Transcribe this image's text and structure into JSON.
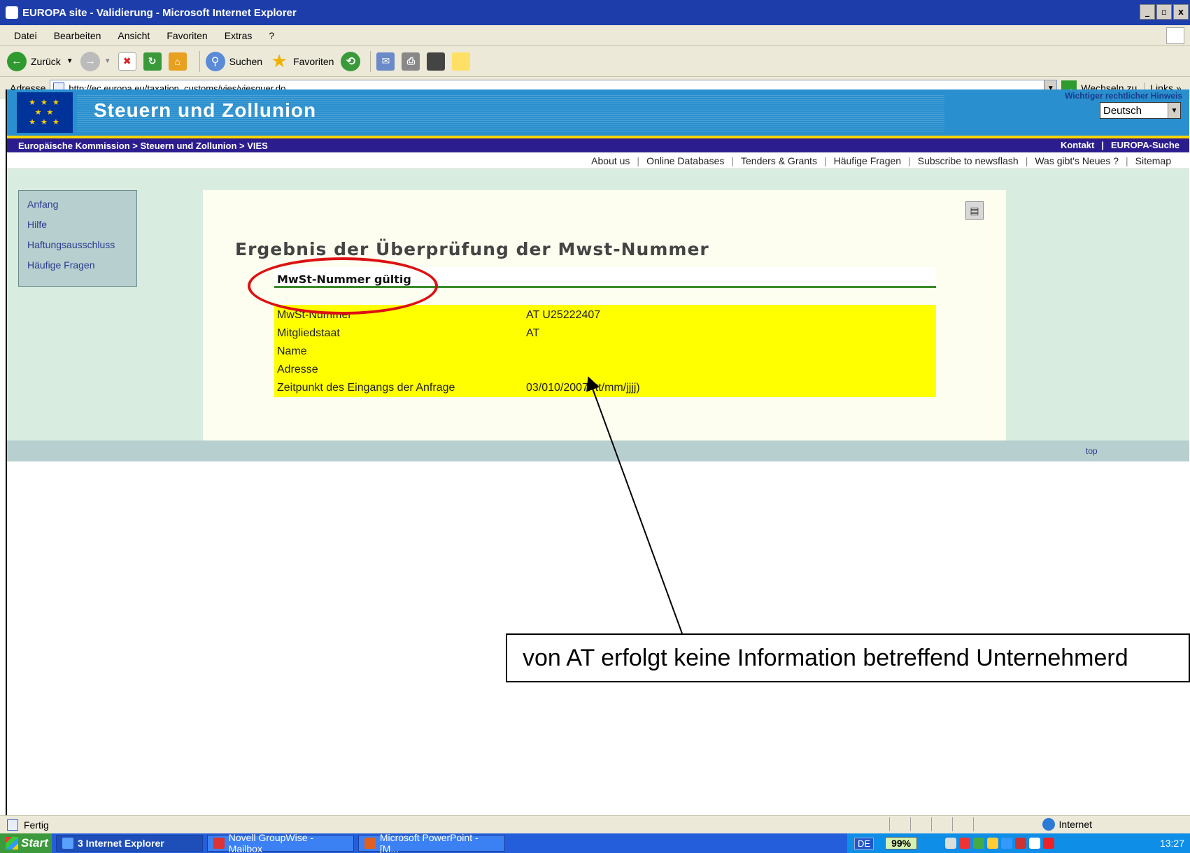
{
  "window": {
    "title": "EUROPA site - Validierung - Microsoft Internet Explorer",
    "controls": [
      "_",
      " ",
      "x"
    ]
  },
  "menu": [
    "Datei",
    "Bearbeiten",
    "Ansicht",
    "Favoriten",
    "Extras",
    "?"
  ],
  "toolbar": {
    "back_label": "Zurück",
    "search_label": "Suchen",
    "favorites_label": "Favoriten"
  },
  "address": {
    "label": "Adresse",
    "url": "http://ec.europa.eu/taxation_customs/vies/viesquer.do",
    "go_label": "Wechseln zu",
    "links_label": "Links »"
  },
  "banner": {
    "site_title": "Steuern und Zollunion",
    "legal_notice": "Wichtiger rechtlicher Hinweis",
    "language": "Deutsch"
  },
  "breadcrumb": "Europäische Kommission > Steuern und Zollunion > VIES",
  "nav_right": [
    "Kontakt",
    "EUROPA-Suche"
  ],
  "top_links": [
    "About us",
    "Online Databases",
    "Tenders & Grants",
    "Häufige Fragen",
    "Subscribe to newsflash",
    "Was gibt's Neues ?",
    "Sitemap"
  ],
  "left_nav": [
    "Anfang",
    "Hilfe",
    "Haftungsausschluss",
    "Häufige Fragen"
  ],
  "main": {
    "heading": "Ergebnis der Überprüfung der Mwst-Nummer",
    "result": "MwSt-Nummer gültig",
    "rows": [
      {
        "key": "MwSt-Nummer",
        "value": "AT U25222407"
      },
      {
        "key": "Mitgliedstaat",
        "value": "AT"
      },
      {
        "key": "Name",
        "value": ""
      },
      {
        "key": "Adresse",
        "value": ""
      },
      {
        "key": "Zeitpunkt des Eingangs der Anfrage",
        "value": "03/010/2007 (tt/mm/jjjj)"
      }
    ]
  },
  "footer_top_link": "top",
  "annotation": "von AT erfolgt keine Information betreffend Unternehmerd",
  "status": {
    "text": "Fertig",
    "zone": "Internet"
  },
  "taskbar": {
    "start_label": "Start",
    "tasks": [
      "3 Internet Explorer",
      "Novell GroupWise - Mailbox",
      "Microsoft PowerPoint - [M..."
    ],
    "lang": "DE",
    "battery": "99%",
    "clock": "13:27"
  },
  "colors": {
    "banner_blue": "#2a8fce",
    "nav_purple": "#2c1d8f",
    "highlight_yellow": "#ffff00",
    "annotation_red": "#dd1111"
  }
}
